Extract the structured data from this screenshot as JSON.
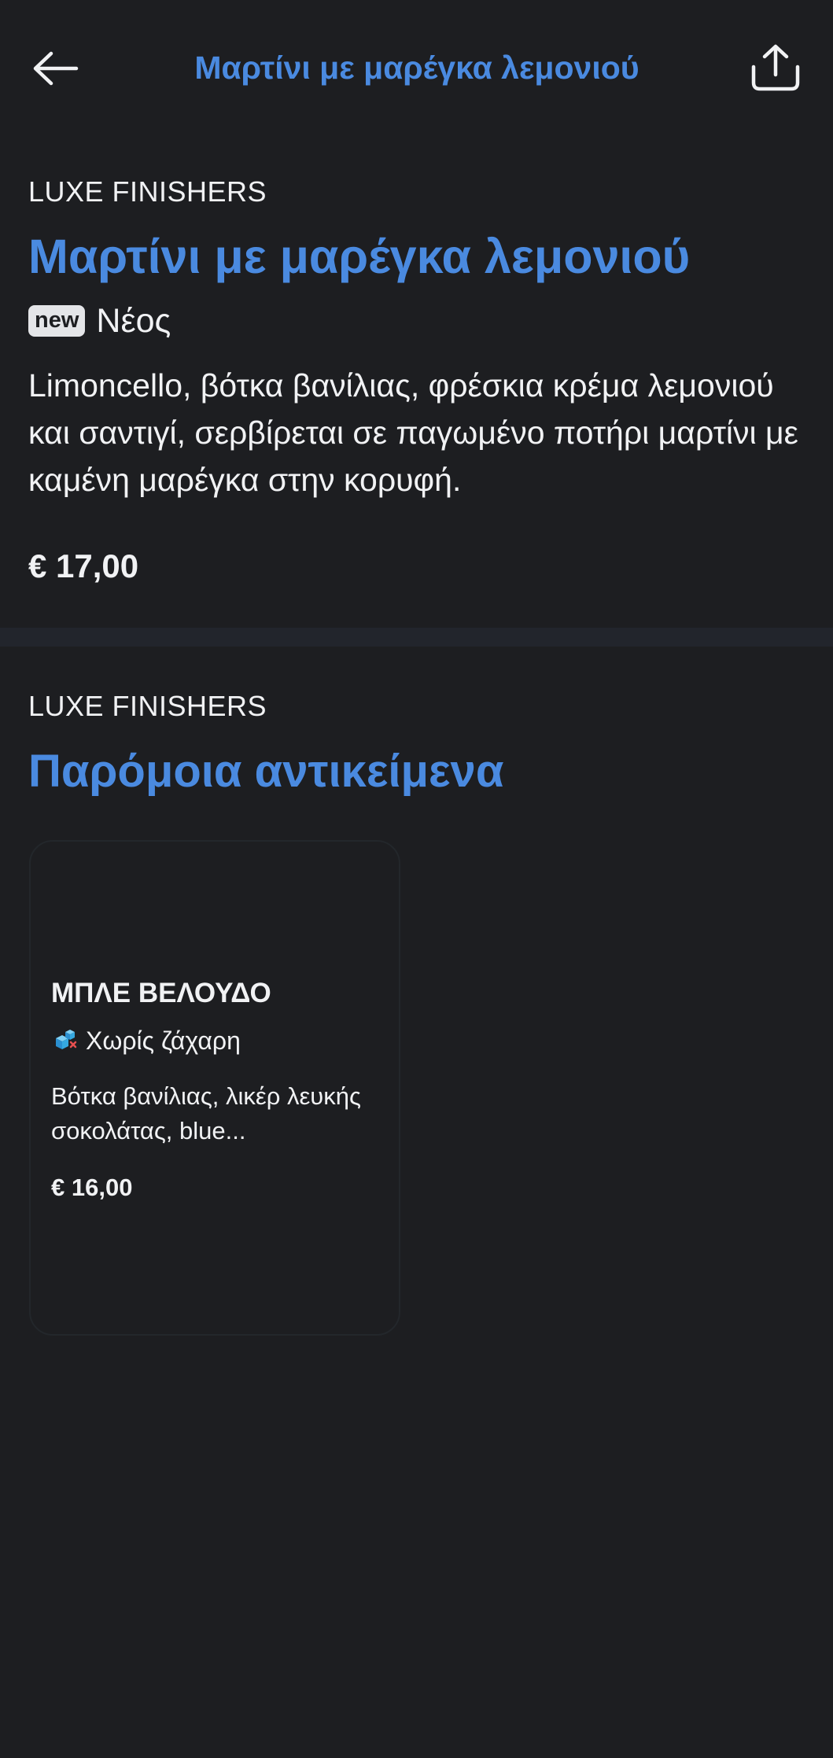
{
  "header": {
    "title": "Μαρτίνι με μαρέγκα λεμονιού",
    "back_icon": "arrow-left-icon",
    "share_icon": "share-upload-icon"
  },
  "product": {
    "category": "LUXE FINISHERS",
    "name": "Μαρτίνι με μαρέγκα λεμονιού",
    "badge": "new",
    "badge_label": "Νέος",
    "description": "Limoncello, βότκα βανίλιας, φρέσκια κρέμα λεμονιού και σαντιγί, σερβίρεται σε παγωμένο ποτήρι μαρτίνι με καμένη μαρέγκα στην κορυφή.",
    "price": "€ 17,00"
  },
  "similar": {
    "category": "LUXE FINISHERS",
    "title": "Παρόμοια αντικείμενα",
    "items": [
      {
        "name": "ΜΠΛΕ ΒΕΛΟΥΔΟ",
        "tag_icon": "sugar-cube-icon",
        "tag": "Χωρίς ζάχαρη",
        "description": "Βότκα βανίλιας, λικέρ λευκής σοκολάτας, blue...",
        "price": "€ 16,00"
      }
    ]
  },
  "colors": {
    "background": "#1d1e21",
    "accent": "#4a8ae0",
    "text": "#f1f2f4",
    "badge_bg": "#e4e5e8",
    "divider": "#22252c",
    "sugar_icon": "#35a8e0"
  }
}
